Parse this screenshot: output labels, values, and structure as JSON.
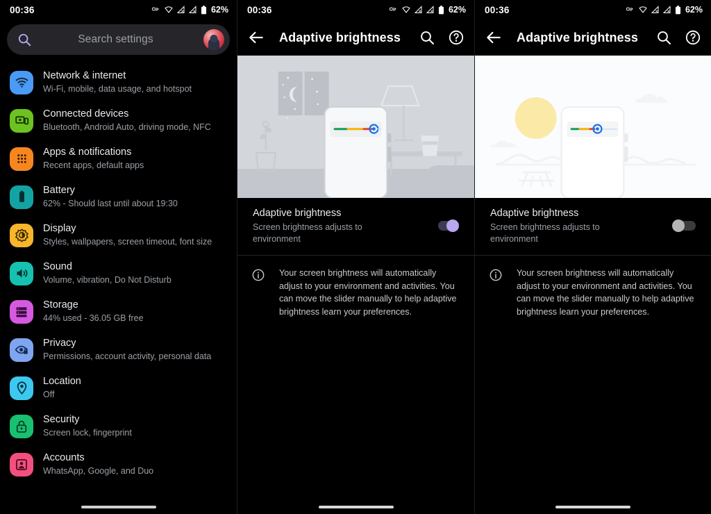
{
  "statusbar": {
    "time": "00:36",
    "battery_percent": "62%",
    "icons": [
      "vpn-key-icon",
      "wifi-icon",
      "signal-1-icon",
      "signal-2-icon",
      "battery-icon"
    ]
  },
  "settings_screen": {
    "search": {
      "placeholder": "Search settings",
      "icon": "search-icon",
      "avatar": "account-avatar"
    },
    "items": [
      {
        "title": "Network & internet",
        "subtitle": "Wi-Fi, mobile, data usage, and hotspot",
        "icon": "wifi-icon",
        "color": "#4a9bf5"
      },
      {
        "title": "Connected devices",
        "subtitle": "Bluetooth, Android Auto, driving mode, NFC",
        "icon": "devices-icon",
        "color": "#6cc221"
      },
      {
        "title": "Apps & notifications",
        "subtitle": "Recent apps, default apps",
        "icon": "apps-grid-icon",
        "color": "#f6871f"
      },
      {
        "title": "Battery",
        "subtitle": "62% - Should last until about 19:30",
        "icon": "battery-icon",
        "color": "#13a3a3"
      },
      {
        "title": "Display",
        "subtitle": "Styles, wallpapers, screen timeout, font size",
        "icon": "brightness-icon",
        "color": "#f6b52b"
      },
      {
        "title": "Sound",
        "subtitle": "Volume, vibration, Do Not Disturb",
        "icon": "volume-icon",
        "color": "#16c1b0"
      },
      {
        "title": "Storage",
        "subtitle": "44% used - 36.05 GB free",
        "icon": "storage-icon",
        "color": "#d65ae0"
      },
      {
        "title": "Privacy",
        "subtitle": "Permissions, account activity, personal data",
        "icon": "privacy-eye-icon",
        "color": "#7fa5f0"
      },
      {
        "title": "Location",
        "subtitle": "Off",
        "icon": "location-pin-icon",
        "color": "#3cc8ef"
      },
      {
        "title": "Security",
        "subtitle": "Screen lock, fingerprint",
        "icon": "lock-icon",
        "color": "#18c070"
      },
      {
        "title": "Accounts",
        "subtitle": "WhatsApp, Google, and Duo",
        "icon": "account-box-icon",
        "color": "#f24f7f"
      }
    ]
  },
  "detail_on": {
    "appbar": {
      "title": "Adaptive brightness",
      "back_icon": "arrow-back-icon",
      "search_icon": "search-icon",
      "help_icon": "help-circle-icon"
    },
    "illustration": {
      "name": "night-room-illustration",
      "scene": "night",
      "background": "#d3d6db",
      "slider_fill": [
        "#0f9d58",
        "#f4b400",
        "#db4437"
      ],
      "slider_handle": "#1a73e8"
    },
    "toggle": {
      "title": "Adaptive brightness",
      "subtitle": "Screen brightness adjusts to environment",
      "state": "on",
      "thumb_color": "#b9a7f0",
      "track_color": "#3d3a52"
    },
    "info": {
      "icon": "info-circle-icon",
      "text": "Your screen brightness will automatically adjust to your environment and activities. You can move the slider manually to help adaptive brightness learn your preferences."
    }
  },
  "detail_off": {
    "appbar": {
      "title": "Adaptive brightness",
      "back_icon": "arrow-back-icon",
      "search_icon": "search-icon",
      "help_icon": "help-circle-icon"
    },
    "illustration": {
      "name": "day-outdoor-illustration",
      "scene": "day",
      "background": "#fbfcfd",
      "sun_color": "#fbe9a7",
      "slider_fill": [
        "#0f9d58",
        "#f4b400",
        "#db4437"
      ],
      "slider_handle": "#1a73e8"
    },
    "toggle": {
      "title": "Adaptive brightness",
      "subtitle": "Screen brightness adjusts to environment",
      "state": "off",
      "thumb_color": "#b4b4b4",
      "track_color": "#3c3c3f"
    },
    "info": {
      "icon": "info-circle-icon",
      "text": "Your screen brightness will automatically adjust to your environment and activities. You can move the slider manually to help adaptive brightness learn your preferences."
    }
  }
}
